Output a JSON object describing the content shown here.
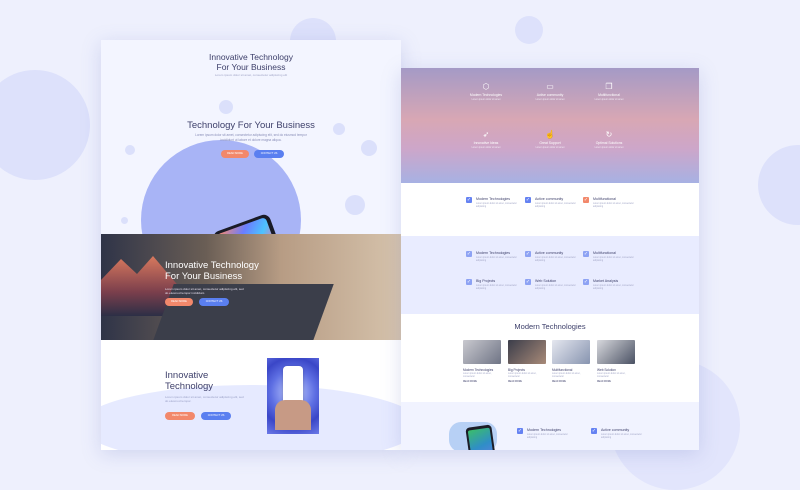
{
  "colors": {
    "accent_orange": "#f2886b",
    "accent_blue": "#5a7ff0",
    "check_blue": "#6582f2",
    "check_orange": "#f2886b",
    "background": "#eef0fd"
  },
  "left": {
    "header": {
      "title_line1": "Innovative Technology",
      "title_line2": "For Your Business",
      "subtitle": "Lorem ipsum dolor sit amet, consectetur adipiscing elit"
    },
    "hero": {
      "title": "Technology For Your Business",
      "text": "Lorem ipsum dolor sit amet, consectetur adipiscing elit, sed do eiusmod tempor incididunt ut labore et dolore magna aliqua.",
      "button1": "READ MORE",
      "button2": "CONTACT US"
    },
    "photo": {
      "title_line1": "Innovative Technology",
      "title_line2": "For Your Business",
      "text": "Lorem ipsum dolor sit amet, consectetur adipiscing elit, sed do eiusmod tempor incididunt.",
      "button1": "READ MORE",
      "button2": "CONTACT US"
    },
    "section3": {
      "title_line1": "Innovative",
      "title_line2": "Technology",
      "text": "Lorem ipsum dolor sit amet, consectetur adipiscing elit, sed do eiusmod tempor.",
      "button1": "READ MORE",
      "button2": "CONTACT US"
    }
  },
  "right": {
    "features": [
      {
        "icon": "cube-icon",
        "glyph": "⬡",
        "label": "Modern Technologies",
        "sub": "Lorem ipsum dolor sit amet"
      },
      {
        "icon": "chat-icon",
        "glyph": "▭",
        "label": "Active community",
        "sub": "Lorem ipsum dolor sit amet"
      },
      {
        "icon": "layers-icon",
        "glyph": "❐",
        "label": "Multifunctional",
        "sub": "Lorem ipsum dolor sit amet"
      },
      {
        "icon": "rocket-icon",
        "glyph": "➶",
        "label": "Innovative Ideas",
        "sub": "Lorem ipsum dolor sit amet"
      },
      {
        "icon": "thumbs-up-icon",
        "glyph": "☝",
        "label": "Great Support",
        "sub": "Lorem ipsum dolor sit amet"
      },
      {
        "icon": "refresh-icon",
        "glyph": "↻",
        "label": "Optimal Solutions",
        "sub": "Lorem ipsum dolor sit amet"
      }
    ],
    "check_row1": [
      {
        "label": "Modern Technologies",
        "desc": "Lorem ipsum dolor sit amet, consectetur adipiscing"
      },
      {
        "label": "Active community",
        "desc": "Lorem ipsum dolor sit amet, consectetur adipiscing"
      },
      {
        "label": "Multifunctional",
        "desc": "Lorem ipsum dolor sit amet, consectetur adipiscing"
      }
    ],
    "check_grid": [
      {
        "label": "Modern Technologies",
        "desc": "Lorem ipsum dolor sit amet, consectetur adipiscing"
      },
      {
        "label": "Active community",
        "desc": "Lorem ipsum dolor sit amet, consectetur adipiscing"
      },
      {
        "label": "Multifunctional",
        "desc": "Lorem ipsum dolor sit amet, consectetur adipiscing"
      },
      {
        "label": "Big Projects",
        "desc": "Lorem ipsum dolor sit amet, consectetur adipiscing"
      },
      {
        "label": "Web Solution",
        "desc": "Lorem ipsum dolor sit amet, consectetur adipiscing"
      },
      {
        "label": "Market Analysis",
        "desc": "Lorem ipsum dolor sit amet, consectetur adipiscing"
      }
    ],
    "modern": {
      "title": "Modern Technologies",
      "cards": [
        {
          "title": "Modern Technologies",
          "desc": "Lorem ipsum dolor sit amet, consectetur",
          "more": "READ MORE"
        },
        {
          "title": "Big Projects",
          "desc": "Lorem ipsum dolor sit amet, consectetur",
          "more": "READ MORE"
        },
        {
          "title": "Multifunctional",
          "desc": "Lorem ipsum dolor sit amet, consectetur",
          "more": "READ MORE"
        },
        {
          "title": "Web Solution",
          "desc": "Lorem ipsum dolor sit amet, consectetur",
          "more": "READ MORE"
        }
      ]
    },
    "bottom": [
      {
        "label": "Modern Technologies",
        "desc": "Lorem ipsum dolor sit amet, consectetur adipiscing"
      },
      {
        "label": "Active community",
        "desc": "Lorem ipsum dolor sit amet, consectetur adipiscing"
      }
    ]
  }
}
